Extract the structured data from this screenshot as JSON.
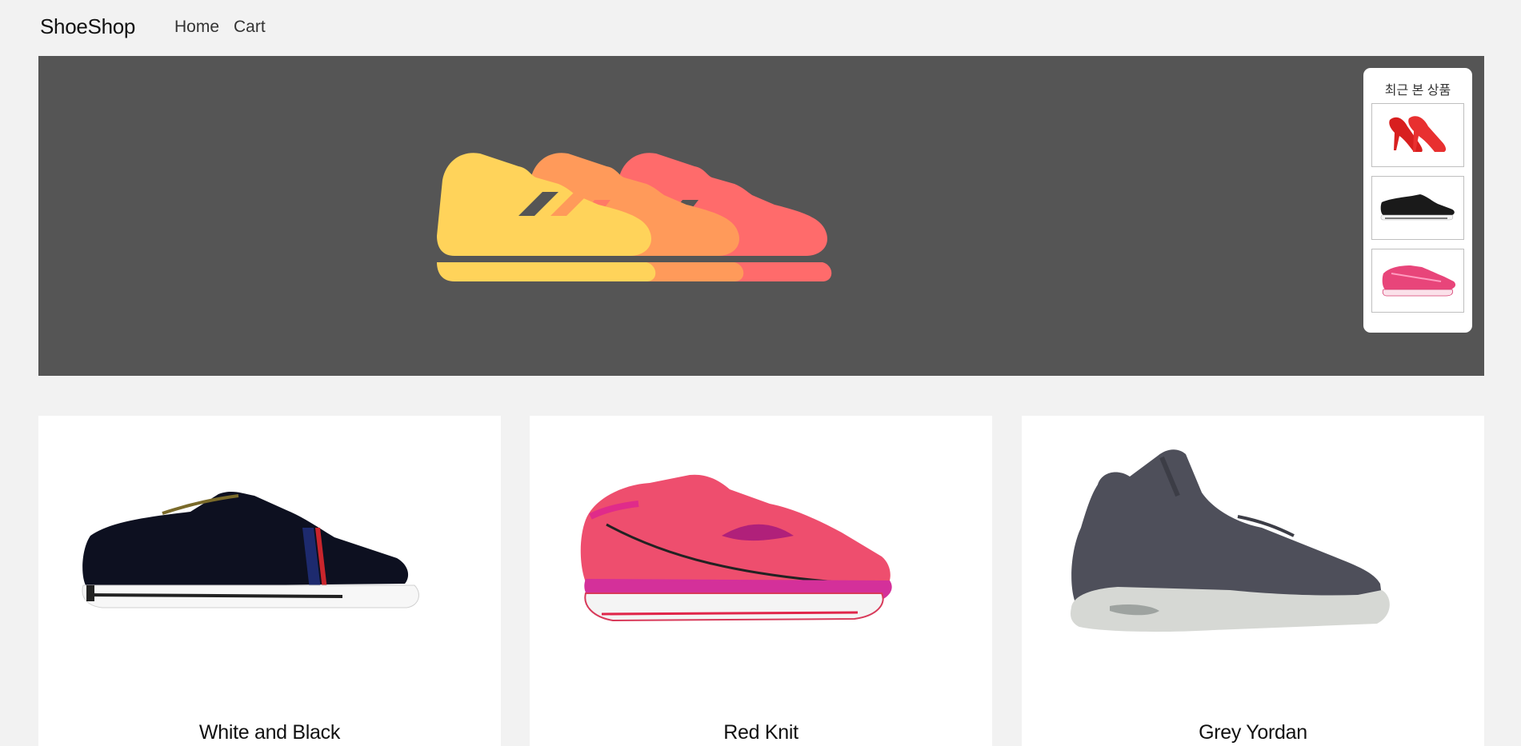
{
  "nav": {
    "brand": "ShoeShop",
    "links": [
      "Home",
      "Cart"
    ]
  },
  "hero": {
    "icon": "sneakers-illustration",
    "colors": [
      "#ffd35a",
      "#ff9a5a",
      "#ff6b6b"
    ],
    "background": "#555555"
  },
  "recent": {
    "title": "최근 본 상품",
    "items": [
      {
        "icon": "red-heels-thumbnail"
      },
      {
        "icon": "black-sneaker-thumbnail"
      },
      {
        "icon": "pink-runner-thumbnail"
      }
    ]
  },
  "products": [
    {
      "title": "White and Black",
      "icon": "black-canvas-sneaker"
    },
    {
      "title": "Red Knit",
      "icon": "pink-running-shoe"
    },
    {
      "title": "Grey Yordan",
      "icon": "grey-high-top-sneaker"
    }
  ]
}
